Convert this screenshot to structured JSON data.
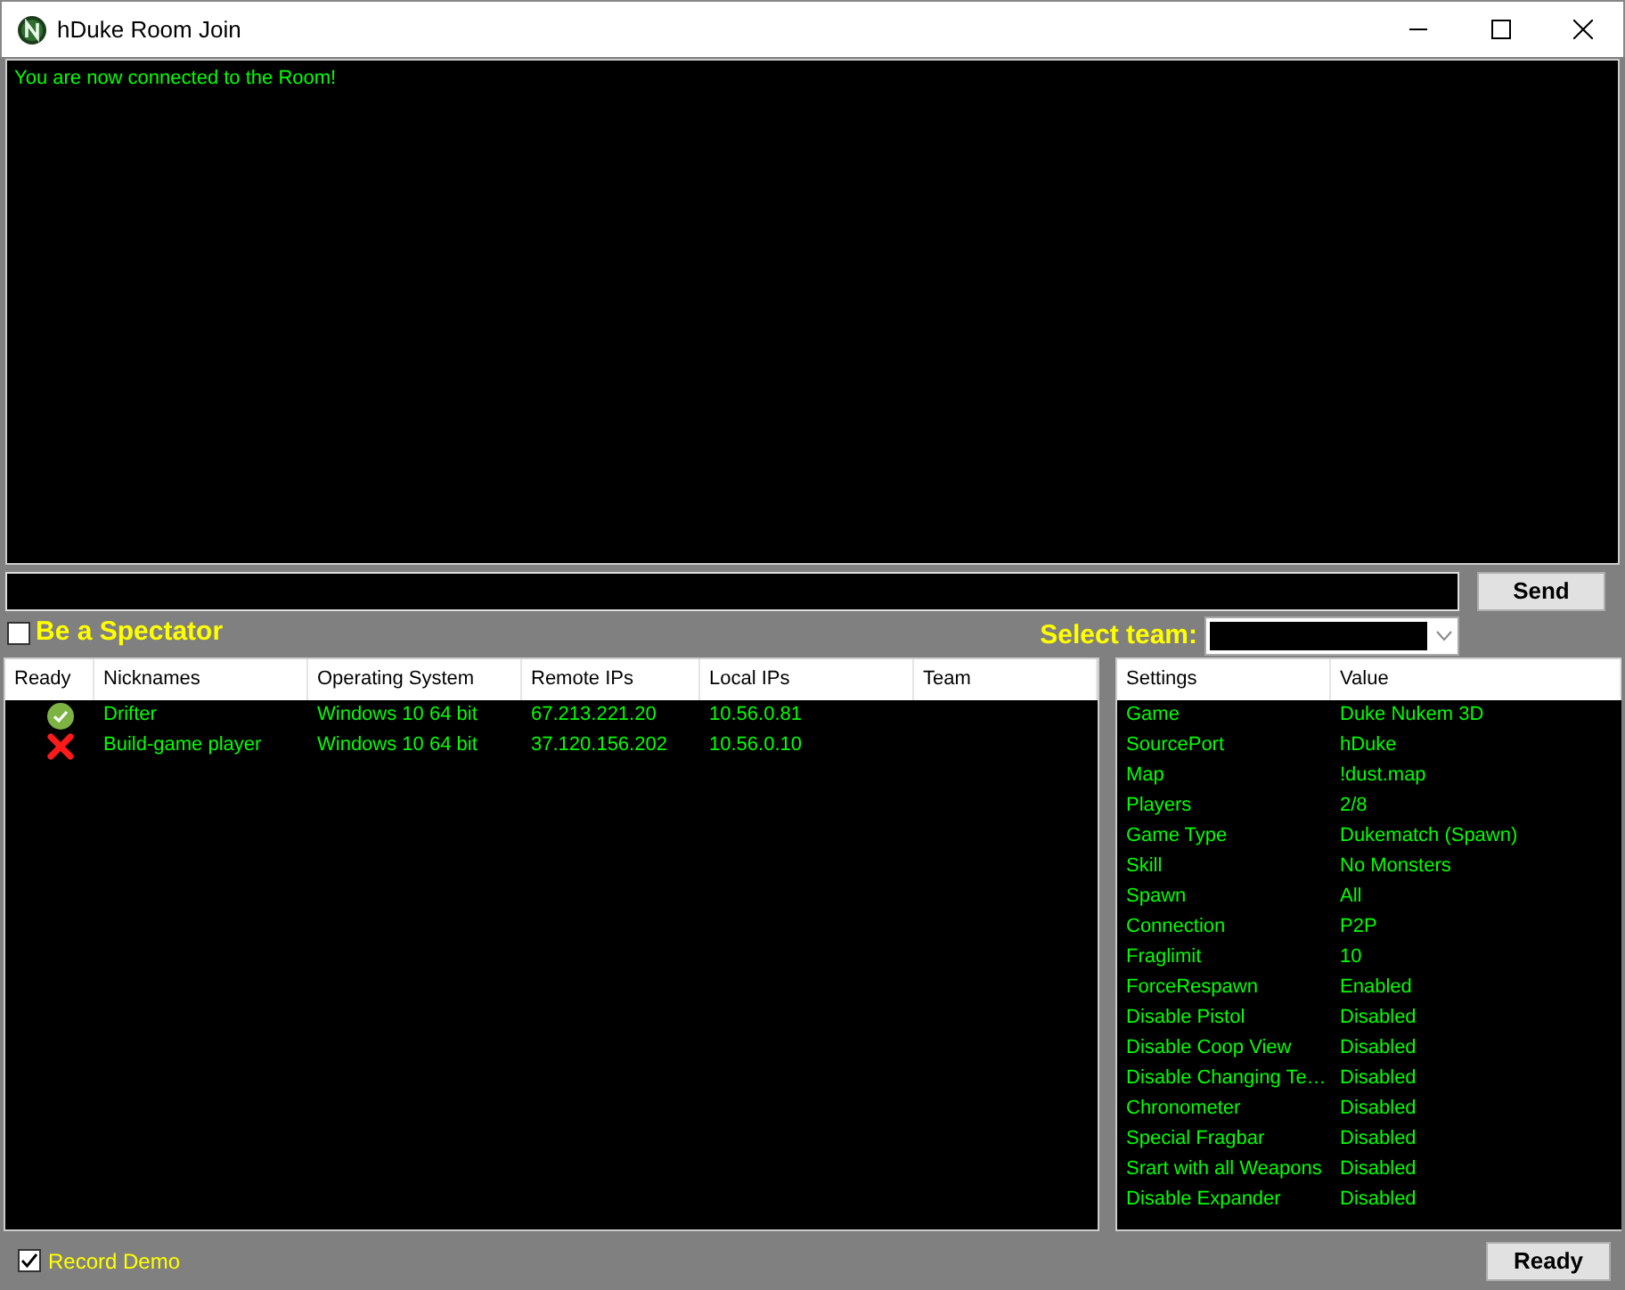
{
  "window": {
    "title": "hDuke Room Join"
  },
  "chat": {
    "messages": [
      "You are now connected to the Room!"
    ]
  },
  "send_button": "Send",
  "spectator": {
    "label": "Be a Spectator",
    "checked": false
  },
  "team": {
    "label": "Select team:"
  },
  "players": {
    "columns": [
      "Ready",
      "Nicknames",
      "Operating System",
      "Remote IPs",
      "Local IPs",
      "Team"
    ],
    "rows": [
      {
        "ready": true,
        "nickname": "Drifter",
        "os": "Windows 10 64 bit",
        "remote_ip": "67.213.221.20",
        "local_ip": "10.56.0.81"
      },
      {
        "ready": false,
        "nickname": "Build-game player",
        "os": "Windows 10 64 bit",
        "remote_ip": "37.120.156.202",
        "local_ip": "10.56.0.10"
      }
    ]
  },
  "settings": {
    "columns": [
      "Settings",
      "Value"
    ],
    "rows": [
      {
        "name": "Game",
        "value": "Duke Nukem 3D"
      },
      {
        "name": "SourcePort",
        "value": "hDuke"
      },
      {
        "name": "Map",
        "value": "!dust.map"
      },
      {
        "name": "Players",
        "value": "2/8"
      },
      {
        "name": "Game Type",
        "value": "Dukematch (Spawn)"
      },
      {
        "name": "Skill",
        "value": "No Monsters"
      },
      {
        "name": "Spawn",
        "value": "All"
      },
      {
        "name": "Connection",
        "value": "P2P"
      },
      {
        "name": "Fraglimit",
        "value": "10"
      },
      {
        "name": "ForceRespawn",
        "value": "Enabled"
      },
      {
        "name": "Disable Pistol",
        "value": "Disabled"
      },
      {
        "name": "Disable Coop View",
        "value": "Disabled"
      },
      {
        "name": "Disable Changing Te…",
        "value": "Disabled"
      },
      {
        "name": "Chronometer",
        "value": "Disabled"
      },
      {
        "name": "Special Fragbar",
        "value": "Disabled"
      },
      {
        "name": "Srart with all Weapons",
        "value": "Disabled"
      },
      {
        "name": "Disable Expander",
        "value": "Disabled"
      }
    ]
  },
  "record_demo": {
    "label": "Record Demo",
    "checked": true
  },
  "ready_button": "Ready"
}
